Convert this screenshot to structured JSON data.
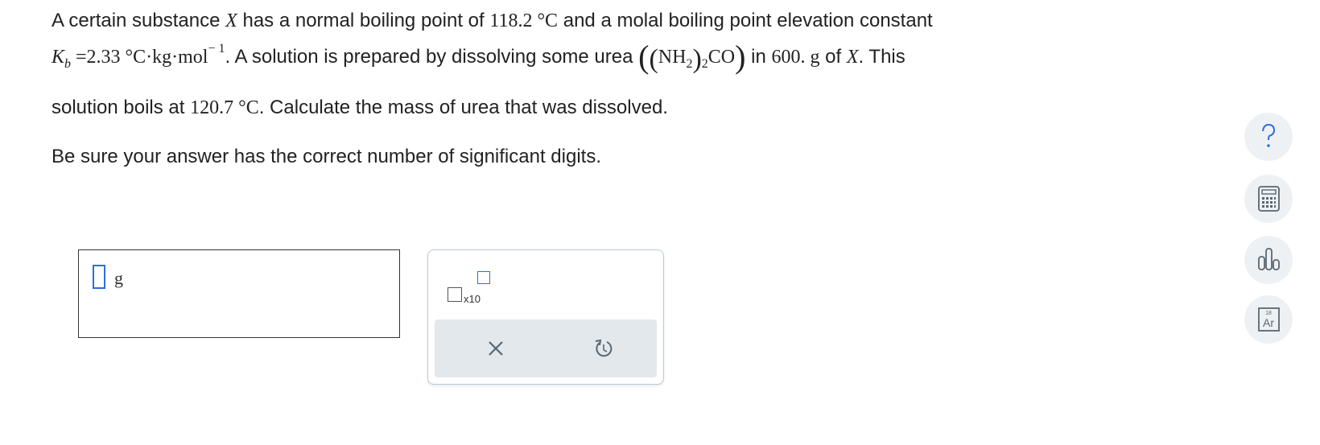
{
  "question": {
    "line1": {
      "t1": "A certain substance ",
      "var_x": "X",
      "t2": " has a normal boiling point of ",
      "bp": "118.2",
      "deg_c": " °C",
      "t3": " and a molal boiling point elevation constant"
    },
    "line2": {
      "k": "K",
      "k_sub": "b",
      "eq": " =2.33 °C·kg·mol",
      "exp": "− 1",
      "t1": ". A solution is prepared by dissolving some urea ",
      "paren_open": "(",
      "inner_open": "(",
      "nh": "NH",
      "nh_sub": "2",
      "inner_close": ")",
      "outer_sub": "2",
      "co": "CO",
      "paren_close": ")",
      "t2": " in ",
      "mass": "600. g",
      "t3": " of ",
      "var_x": "X",
      "t4": ". This"
    },
    "line3": {
      "t1": "solution boils at ",
      "temp": "120.7 °C",
      "t2": ". Calculate the mass of urea that was dissolved."
    },
    "instruction": "Be sure your answer has the correct number of significant digits."
  },
  "answer": {
    "value": "",
    "unit": "g"
  },
  "tools": {
    "sci_label": "x10",
    "clear_label": "clear",
    "undo_label": "undo"
  },
  "sidebar": {
    "help_label": "?",
    "periodic_num": "18",
    "periodic_symbol": "Ar"
  },
  "colors": {
    "accent": "#2e6fd8",
    "panel_bg": "#e2e8ec",
    "side_btn_bg": "#eef1f3",
    "icon_gray": "#5a6670"
  }
}
